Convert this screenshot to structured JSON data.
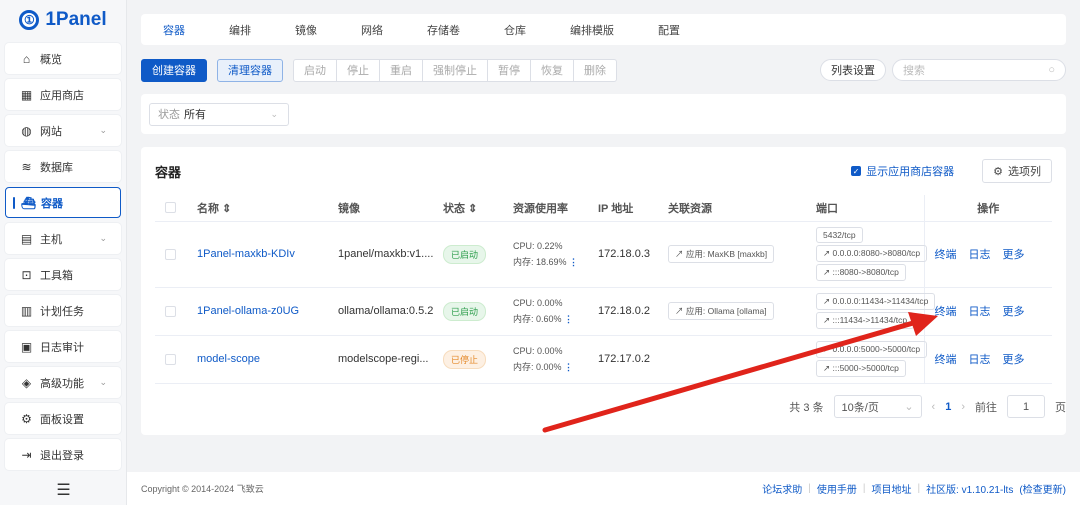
{
  "brand": {
    "name": "1Panel"
  },
  "sidebar": {
    "items": [
      {
        "label": "概览",
        "icon": "home-icon",
        "glyph": "⌂"
      },
      {
        "label": "应用商店",
        "icon": "grid-icon",
        "glyph": "▦"
      },
      {
        "label": "网站",
        "icon": "globe-icon",
        "glyph": "◍",
        "chevron": "⌄"
      },
      {
        "label": "数据库",
        "icon": "layers-icon",
        "glyph": "≋"
      },
      {
        "label": "容器",
        "icon": "docker-icon",
        "glyph": "⛴",
        "active": true
      },
      {
        "label": "主机",
        "icon": "host-icon",
        "glyph": "▤",
        "chevron": "⌄"
      },
      {
        "label": "工具箱",
        "icon": "toolbox-icon",
        "glyph": "⊡"
      },
      {
        "label": "计划任务",
        "icon": "calendar-icon",
        "glyph": "▥"
      },
      {
        "label": "日志审计",
        "icon": "log-icon",
        "glyph": "▣"
      },
      {
        "label": "高级功能",
        "icon": "diamond-icon",
        "glyph": "◈",
        "chevron": "⌄"
      },
      {
        "label": "面板设置",
        "icon": "gear-icon",
        "glyph": "⚙"
      },
      {
        "label": "退出登录",
        "icon": "logout-icon",
        "glyph": "⇥"
      }
    ],
    "collapse_glyph": "☰"
  },
  "tabs": [
    "容器",
    "编排",
    "镜像",
    "网络",
    "存储卷",
    "仓库",
    "编排模版",
    "配置"
  ],
  "toolbar": {
    "create": "创建容器",
    "clean": "清理容器",
    "actions": [
      "启动",
      "停止",
      "重启",
      "强制停止",
      "暂停",
      "恢复",
      "删除"
    ],
    "list_settings": "列表设置",
    "search_placeholder": "搜索"
  },
  "filter": {
    "label": "状态",
    "value": "所有"
  },
  "panel": {
    "title": "容器",
    "show_app_containers": "显示应用商店容器",
    "columns_button": "选项列"
  },
  "table": {
    "headers": {
      "name": "名称",
      "image": "镜像",
      "status": "状态",
      "usage": "资源使用率",
      "ip": "IP 地址",
      "related": "关联资源",
      "ports": "端口",
      "ops": "操作"
    },
    "rows": [
      {
        "name": "1Panel-maxkb-KDIv",
        "image": "1panel/maxkb:v1....",
        "status": "已启动",
        "status_type": "run",
        "cpu": "CPU: 0.22%",
        "mem": "内存: 18.69%",
        "ip": "172.18.0.3",
        "related": "应用: MaxKB [maxkb]",
        "ports": [
          "5432/tcp",
          "0.0.0.0:8080->8080/tcp",
          ":::8080->8080/tcp"
        ],
        "ops": [
          "终端",
          "日志",
          "更多"
        ]
      },
      {
        "name": "1Panel-ollama-z0UG",
        "image": "ollama/ollama:0.5.2",
        "status": "已启动",
        "status_type": "run",
        "cpu": "CPU: 0.00%",
        "mem": "内存: 0.60%",
        "ip": "172.18.0.2",
        "related": "应用: Ollama [ollama]",
        "ports": [
          "0.0.0.0:11434->11434/tcp",
          ":::11434->11434/tcp"
        ],
        "ops": [
          "终端",
          "日志",
          "更多"
        ]
      },
      {
        "name": "model-scope",
        "image": "modelscope-regi...",
        "status": "已停止",
        "status_type": "stop",
        "cpu": "CPU: 0.00%",
        "mem": "内存: 0.00%",
        "ip": "172.17.0.2",
        "related": "",
        "ports": [
          "0.0.0.0:5000->5000/tcp",
          ":::5000->5000/tcp"
        ],
        "ops": [
          "终端",
          "日志",
          "更多"
        ]
      }
    ]
  },
  "pagination": {
    "total": "共 3 条",
    "page_size": "10条/页",
    "current": "1",
    "goto_label": "前往",
    "goto_value": "1",
    "page_suffix": "页"
  },
  "footer": {
    "copyright": "Copyright © 2014-2024 飞致云",
    "links": [
      "论坛求助",
      "使用手册",
      "项目地址"
    ],
    "version": "社区版: v1.10.21-lts",
    "check_update": "(检查更新)"
  },
  "colors": {
    "accent": "#0f5ac7",
    "running": "#2e9e4d",
    "stopped": "#e4892a",
    "annotation_arrow": "#e0241b"
  }
}
